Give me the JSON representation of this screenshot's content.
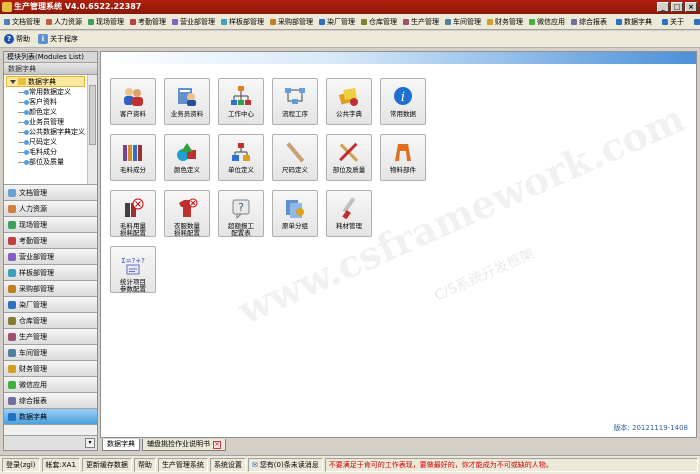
{
  "window": {
    "title": "生产管理系统 V4.0.6522.22387"
  },
  "menubar": {
    "items": [
      "文档管理",
      "人力资源",
      "现场管理",
      "考勤管理",
      "营业部管理",
      "样板部管理",
      "采购部管理",
      "染厂管理",
      "仓库管理",
      "生产管理",
      "车间管理",
      "财务管理",
      "微信应用",
      "综合报表"
    ],
    "right_items": [
      "数据字典",
      "关于",
      "窗口"
    ]
  },
  "toolbar": {
    "help_label": "帮助",
    "about_label": "关于程序"
  },
  "sidebar": {
    "header": "模块列表(Modules List)",
    "section": "数据字典",
    "tree_root": "数据字典",
    "tree_items": [
      "常用数据定义",
      "客户资料",
      "颜色定义",
      "业务员管理",
      "公共数据字典定义",
      "尺码定义",
      "毛料成分",
      "部位及质量"
    ],
    "modules": [
      "文档管理",
      "人力资源",
      "现场管理",
      "考勤管理",
      "营业部管理",
      "样板部管理",
      "采购部管理",
      "染厂管理",
      "仓库管理",
      "生产管理",
      "车间管理",
      "财务管理",
      "微信应用",
      "综合报表",
      "数据字典"
    ],
    "module_colors": [
      "#6aa0d8",
      "#d08040",
      "#40a060",
      "#c04040",
      "#8060c0",
      "#40a0c0",
      "#c08020",
      "#3070c0",
      "#808030",
      "#a05070",
      "#5080a0",
      "#d0a020",
      "#40b040",
      "#7070a0",
      "#2070c0"
    ]
  },
  "main": {
    "tiles": [
      {
        "label": "客户资料",
        "icon": "customers-icon"
      },
      {
        "label": "业务员资料",
        "icon": "salesman-icon"
      },
      {
        "label": "工作中心",
        "icon": "workcenter-icon"
      },
      {
        "label": "流程工序",
        "icon": "process-icon"
      },
      {
        "label": "公共字典",
        "icon": "dictionary-icon"
      },
      {
        "label": "常用数据",
        "icon": "info-icon"
      },
      {
        "label": "毛料成分",
        "icon": "yarn-icon"
      },
      {
        "label": "颜色定义",
        "icon": "color-shapes-icon"
      },
      {
        "label": "单位定义",
        "icon": "unit-icon"
      },
      {
        "label": "尺码定义",
        "icon": "ruler-icon"
      },
      {
        "label": "部位及质量",
        "icon": "tools-icon"
      },
      {
        "label": "物料部件",
        "icon": "garment-icon"
      },
      {
        "label": "毛料用量\n损耗配置",
        "icon": "yarn-loss-icon"
      },
      {
        "label": "衣服数量\n损耗配置",
        "icon": "shirt-loss-icon"
      },
      {
        "label": "超额报工\n配置表",
        "icon": "help-doc-icon"
      },
      {
        "label": "原单分组",
        "icon": "order-group-icon"
      },
      {
        "label": "耗材管理",
        "icon": "knife-icon"
      },
      {
        "label": "统计项目\n参数配置",
        "icon": "formula-icon"
      }
    ],
    "watermark": "www.csframework.com",
    "watermark_sub": "C/S系统开发框架",
    "version": "版本: 20121119-1408"
  },
  "tabs": [
    {
      "label": "数据字典"
    },
    {
      "label": "辅盘挑捡作业说明书"
    }
  ],
  "statusbar": {
    "items": [
      "登录(zgl)",
      "帐套:XA1",
      "更新缓存数据",
      "帮助",
      "生产管理系统",
      "系统设置",
      "您有(0)条未读消息"
    ],
    "warning": "不要满足于肯可的工作表现，要做最好的，你才能成为不可或缺的人物。"
  }
}
